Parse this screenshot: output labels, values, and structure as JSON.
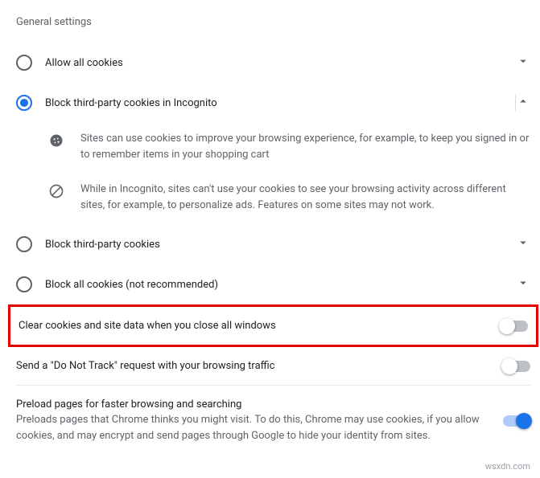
{
  "section_label": "General settings",
  "options": {
    "allow_all": "Allow all cookies",
    "block_incognito": "Block third-party cookies in Incognito",
    "block_third": "Block third-party cookies",
    "block_all": "Block all cookies (not recommended)"
  },
  "details": {
    "cookie_use": "Sites can use cookies to improve your browsing experience, for example, to keep you signed in or to remember items in your shopping cart",
    "incognito_block": "While in Incognito, sites can't use your cookies to see your browsing activity across different sites, for example, to personalize ads. Features on some sites may not work."
  },
  "toggles": {
    "clear_close": "Clear cookies and site data when you close all windows",
    "dnt": "Send a \"Do Not Track\" request with your browsing traffic",
    "preload_title": "Preload pages for faster browsing and searching",
    "preload_desc": "Preloads pages that Chrome thinks you might visit. To do this, Chrome may use cookies, if you allow cookies, and may encrypt and send pages through Google to hide your identity from sites."
  },
  "watermark": "wsxdn.com"
}
